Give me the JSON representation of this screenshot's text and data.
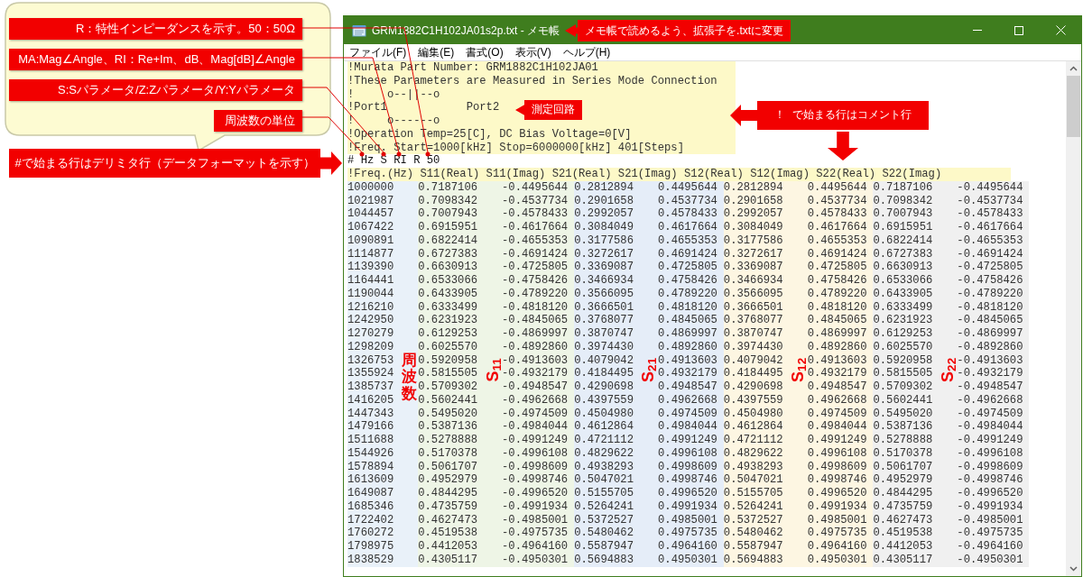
{
  "annotations": {
    "labels": [
      "R：特性インピーダンスを示す。50：50Ω",
      "MA:Mag∠Angle、RI：Re+Im、dB、Mag[dB]∠Angle",
      "S:Sパラメータ/Z:Zパラメータ/Y:Yパラメータ",
      "周波数の単位"
    ],
    "delimiter_note": "#で始まる行はデリミタ行（データフォーマットを示す）",
    "rename_note": "メモ帳で読めるよう、拡張子を.txtに変更",
    "circuit_note": "測定回路",
    "comment_note": "！ で始まる行はコメント行"
  },
  "window": {
    "title": "GRM1882C1H102JA01s2p.txt - メモ帳",
    "menu": [
      "ファイル(F)",
      "編集(E)",
      "書式(O)",
      "表示(V)",
      "ヘルプ(H)"
    ]
  },
  "document": {
    "comment_lines": [
      "!Murata Part Number: GRM1882C1H102JA01",
      "!These Parameters are Measured in Series Mode Connection",
      "!     o--||--o",
      "!Port1            Port2",
      "!     o------o",
      "!Operation Temp=25[C], DC Bias Voltage=0[V]",
      "!Freq. Start=1000[kHz] Stop=6000000[kHz] 401[Steps]"
    ],
    "option_line": "# Hz S RI R 50",
    "header_line": "!Freq.(Hz) S11(Real) S11(Imag) S21(Real) S21(Imag) S12(Real) S12(Imag) S22(Real) S22(Imag)",
    "column_labels": [
      {
        "text": "周波数",
        "kind": "vertical"
      },
      {
        "text": "S$_{11}$",
        "kind": "rotated"
      },
      {
        "text": "S$_{21}$",
        "kind": "rotated"
      },
      {
        "text": "S$_{12}$",
        "kind": "rotated"
      },
      {
        "text": "S$_{22}$",
        "kind": "rotated"
      }
    ],
    "rows": [
      [
        "1000000",
        "0.7187106",
        "-0.4495644",
        "0.2812894",
        "0.4495644",
        "0.2812894",
        "0.4495644",
        "0.7187106",
        "-0.4495644"
      ],
      [
        "1021987",
        "0.7098342",
        "-0.4537734",
        "0.2901658",
        "0.4537734",
        "0.2901658",
        "0.4537734",
        "0.7098342",
        "-0.4537734"
      ],
      [
        "1044457",
        "0.7007943",
        "-0.4578433",
        "0.2992057",
        "0.4578433",
        "0.2992057",
        "0.4578433",
        "0.7007943",
        "-0.4578433"
      ],
      [
        "1067422",
        "0.6915951",
        "-0.4617664",
        "0.3084049",
        "0.4617664",
        "0.3084049",
        "0.4617664",
        "0.6915951",
        "-0.4617664"
      ],
      [
        "1090891",
        "0.6822414",
        "-0.4655353",
        "0.3177586",
        "0.4655353",
        "0.3177586",
        "0.4655353",
        "0.6822414",
        "-0.4655353"
      ],
      [
        "1114877",
        "0.6727383",
        "-0.4691424",
        "0.3272617",
        "0.4691424",
        "0.3272617",
        "0.4691424",
        "0.6727383",
        "-0.4691424"
      ],
      [
        "1139390",
        "0.6630913",
        "-0.4725805",
        "0.3369087",
        "0.4725805",
        "0.3369087",
        "0.4725805",
        "0.6630913",
        "-0.4725805"
      ],
      [
        "1164441",
        "0.6533066",
        "-0.4758426",
        "0.3466934",
        "0.4758426",
        "0.3466934",
        "0.4758426",
        "0.6533066",
        "-0.4758426"
      ],
      [
        "1190044",
        "0.6433905",
        "-0.4789220",
        "0.3566095",
        "0.4789220",
        "0.3566095",
        "0.4789220",
        "0.6433905",
        "-0.4789220"
      ],
      [
        "1216210",
        "0.6333499",
        "-0.4818120",
        "0.3666501",
        "0.4818120",
        "0.3666501",
        "0.4818120",
        "0.6333499",
        "-0.4818120"
      ],
      [
        "1242950",
        "0.6231923",
        "-0.4845065",
        "0.3768077",
        "0.4845065",
        "0.3768077",
        "0.4845065",
        "0.6231923",
        "-0.4845065"
      ],
      [
        "1270279",
        "0.6129253",
        "-0.4869997",
        "0.3870747",
        "0.4869997",
        "0.3870747",
        "0.4869997",
        "0.6129253",
        "-0.4869997"
      ],
      [
        "1298209",
        "0.6025570",
        "-0.4892860",
        "0.3974430",
        "0.4892860",
        "0.3974430",
        "0.4892860",
        "0.6025570",
        "-0.4892860"
      ],
      [
        "1326753",
        "0.5920958",
        "-0.4913603",
        "0.4079042",
        "0.4913603",
        "0.4079042",
        "0.4913603",
        "0.5920958",
        "-0.4913603"
      ],
      [
        "1355924",
        "0.5815505",
        "-0.4932179",
        "0.4184495",
        "0.4932179",
        "0.4184495",
        "0.4932179",
        "0.5815505",
        "-0.4932179"
      ],
      [
        "1385737",
        "0.5709302",
        "-0.4948547",
        "0.4290698",
        "0.4948547",
        "0.4290698",
        "0.4948547",
        "0.5709302",
        "-0.4948547"
      ],
      [
        "1416205",
        "0.5602441",
        "-0.4962668",
        "0.4397559",
        "0.4962668",
        "0.4397559",
        "0.4962668",
        "0.5602441",
        "-0.4962668"
      ],
      [
        "1447343",
        "0.5495020",
        "-0.4974509",
        "0.4504980",
        "0.4974509",
        "0.4504980",
        "0.4974509",
        "0.5495020",
        "-0.4974509"
      ],
      [
        "1479166",
        "0.5387136",
        "-0.4984044",
        "0.4612864",
        "0.4984044",
        "0.4612864",
        "0.4984044",
        "0.5387136",
        "-0.4984044"
      ],
      [
        "1511688",
        "0.5278888",
        "-0.4991249",
        "0.4721112",
        "0.4991249",
        "0.4721112",
        "0.4991249",
        "0.5278888",
        "-0.4991249"
      ],
      [
        "1544926",
        "0.5170378",
        "-0.4996108",
        "0.4829622",
        "0.4996108",
        "0.4829622",
        "0.4996108",
        "0.5170378",
        "-0.4996108"
      ],
      [
        "1578894",
        "0.5061707",
        "-0.4998609",
        "0.4938293",
        "0.4998609",
        "0.4938293",
        "0.4998609",
        "0.5061707",
        "-0.4998609"
      ],
      [
        "1613609",
        "0.4952979",
        "-0.4998746",
        "0.5047021",
        "0.4998746",
        "0.5047021",
        "0.4998746",
        "0.4952979",
        "-0.4998746"
      ],
      [
        "1649087",
        "0.4844295",
        "-0.4996520",
        "0.5155705",
        "0.4996520",
        "0.5155705",
        "0.4996520",
        "0.4844295",
        "-0.4996520"
      ],
      [
        "1685346",
        "0.4735759",
        "-0.4991934",
        "0.5264241",
        "0.4991934",
        "0.5264241",
        "0.4991934",
        "0.4735759",
        "-0.4991934"
      ],
      [
        "1722402",
        "0.4627473",
        "-0.4985001",
        "0.5372527",
        "0.4985001",
        "0.5372527",
        "0.4985001",
        "0.4627473",
        "-0.4985001"
      ],
      [
        "1760272",
        "0.4519538",
        "-0.4975735",
        "0.5480462",
        "0.4975735",
        "0.5480462",
        "0.4975735",
        "0.4519538",
        "-0.4975735"
      ],
      [
        "1798975",
        "0.4412053",
        "-0.4964160",
        "0.5587947",
        "0.4964160",
        "0.5587947",
        "0.4964160",
        "0.4412053",
        "-0.4964160"
      ],
      [
        "1838529",
        "0.4305117",
        "-0.4950301",
        "0.5694883",
        "0.4950301",
        "0.5694883",
        "0.4950301",
        "0.4305117",
        "-0.4950301"
      ]
    ]
  }
}
